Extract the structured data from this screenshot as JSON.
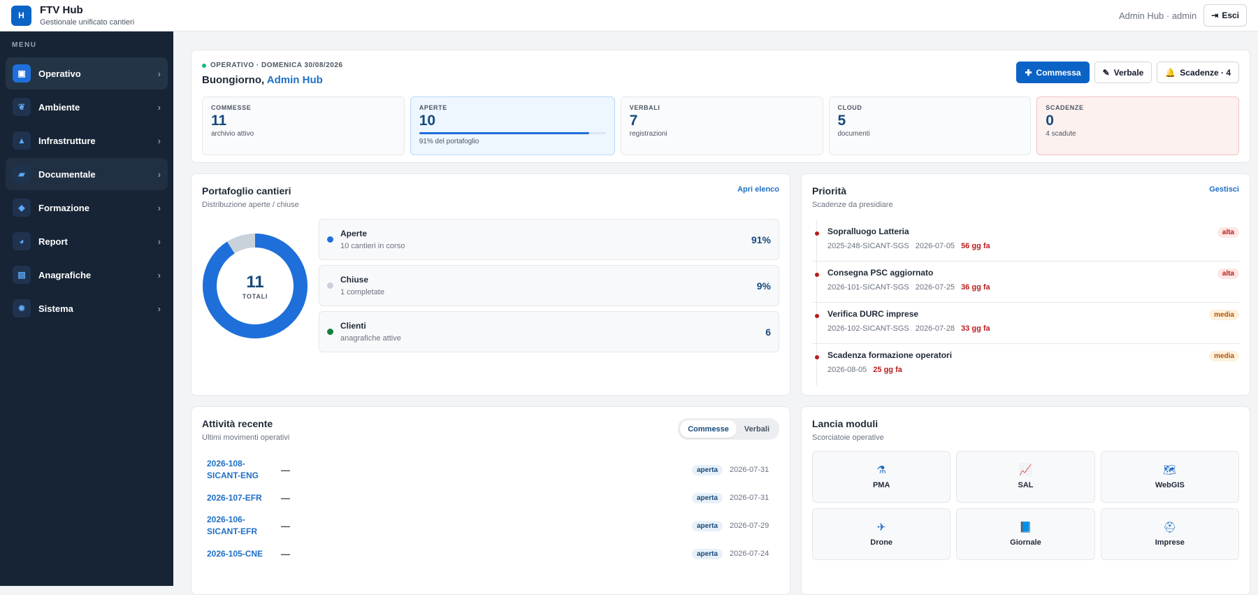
{
  "app": {
    "logo_letter": "H",
    "title": "FTV Hub",
    "subtitle": "Gestionale unificato cantieri"
  },
  "topbar": {
    "user": "Admin Hub · admin",
    "logout_label": "Esci"
  },
  "sidebar": {
    "menu_label": "MENU",
    "items": [
      {
        "label": "Operativo",
        "icon": "briefcase-icon",
        "glyph": "▣"
      },
      {
        "label": "Ambiente",
        "icon": "leaf-icon",
        "glyph": "❦"
      },
      {
        "label": "Infrastrutture",
        "icon": "road-icon",
        "glyph": "▲"
      },
      {
        "label": "Documentale",
        "icon": "folder-icon",
        "glyph": "▰"
      },
      {
        "label": "Formazione",
        "icon": "graduation-cap-icon",
        "glyph": "◆"
      },
      {
        "label": "Report",
        "icon": "pie-chart-icon",
        "glyph": "◕"
      },
      {
        "label": "Anagrafiche",
        "icon": "id-card-icon",
        "glyph": "▤"
      },
      {
        "label": "Sistema",
        "icon": "gear-icon",
        "glyph": "✹"
      }
    ]
  },
  "hero": {
    "status": "OPERATIVO · DOMENICA 30/08/2026",
    "greeting": "Buongiorno,",
    "user_name": "Admin Hub",
    "actions": {
      "commessa": "Commessa",
      "verbale": "Verbale",
      "scadenze": "Scadenze · 4"
    },
    "kpis": [
      {
        "label": "COMMESSE",
        "value": "11",
        "sub": "archivio attivo"
      },
      {
        "label": "APERTE",
        "value": "10",
        "sub": "91% del portafoglio",
        "progress": 0.91
      },
      {
        "label": "VERBALI",
        "value": "7",
        "sub": "registrazioni"
      },
      {
        "label": "CLOUD",
        "value": "5",
        "sub": "documenti"
      },
      {
        "label": "SCADENZE",
        "value": "0",
        "sub": "4 scadute"
      }
    ]
  },
  "portfolio": {
    "title": "Portafoglio cantieri",
    "subtitle": "Distribuzione aperte / chiuse",
    "link": "Apri elenco",
    "total": "11",
    "total_label": "TOTALI",
    "donut_fraction_open": 0.91,
    "colors": {
      "open": "#1e6fd9",
      "closed": "#c9d1db",
      "clients": "#15803d"
    },
    "rows": [
      {
        "name": "Aperte",
        "sub": "10 cantieri in corso",
        "value": "91%"
      },
      {
        "name": "Chiuse",
        "sub": "1 completate",
        "value": "9%"
      },
      {
        "name": "Clienti",
        "sub": "anagrafiche attive",
        "value": "6"
      }
    ]
  },
  "priority": {
    "title": "Priorità",
    "subtitle": "Scadenze da presidiare",
    "link": "Gestisci",
    "items": [
      {
        "title": "Sopralluogo Latteria",
        "code": "2025-248-SICANT-SGS",
        "date": "2026-07-05",
        "late": "56 gg fa",
        "tag": "alta"
      },
      {
        "title": "Consegna PSC aggiornato",
        "code": "2026-101-SICANT-SGS",
        "date": "2026-07-25",
        "late": "36 gg fa",
        "tag": "alta"
      },
      {
        "title": "Verifica DURC imprese",
        "code": "2026-102-SICANT-SGS",
        "date": "2026-07-28",
        "late": "33 gg fa",
        "tag": "media"
      },
      {
        "title": "Scadenza formazione operatori",
        "code": "",
        "date": "2026-08-05",
        "late": "25 gg fa",
        "tag": "media"
      }
    ]
  },
  "activity": {
    "title": "Attività recente",
    "subtitle": "Ultimi movimenti operativi",
    "tabs": [
      "Commesse",
      "Verbali"
    ],
    "rows": [
      {
        "code": "2026-108-SICANT-ENG",
        "desc": "—",
        "status": "aperta",
        "date": "2026-07-31"
      },
      {
        "code": "2026-107-EFR",
        "desc": "—",
        "status": "aperta",
        "date": "2026-07-31"
      },
      {
        "code": "2026-106-SICANT-EFR",
        "desc": "—",
        "status": "aperta",
        "date": "2026-07-29"
      },
      {
        "code": "2026-105-CNE",
        "desc": "—",
        "status": "aperta",
        "date": "2026-07-24"
      }
    ]
  },
  "modules": {
    "title": "Lancia moduli",
    "subtitle": "Scorciatoie operative",
    "items": [
      {
        "label": "PMA",
        "icon": "flask-icon",
        "glyph": "⚗"
      },
      {
        "label": "SAL",
        "icon": "line-chart-icon",
        "glyph": "📈"
      },
      {
        "label": "WebGIS",
        "icon": "map-icon",
        "glyph": "🗺"
      },
      {
        "label": "Drone",
        "icon": "drone-icon",
        "glyph": "✈"
      },
      {
        "label": "Giornale",
        "icon": "book-icon",
        "glyph": "📘"
      },
      {
        "label": "Imprese",
        "icon": "hard-hat-icon",
        "glyph": "⛑"
      }
    ]
  }
}
